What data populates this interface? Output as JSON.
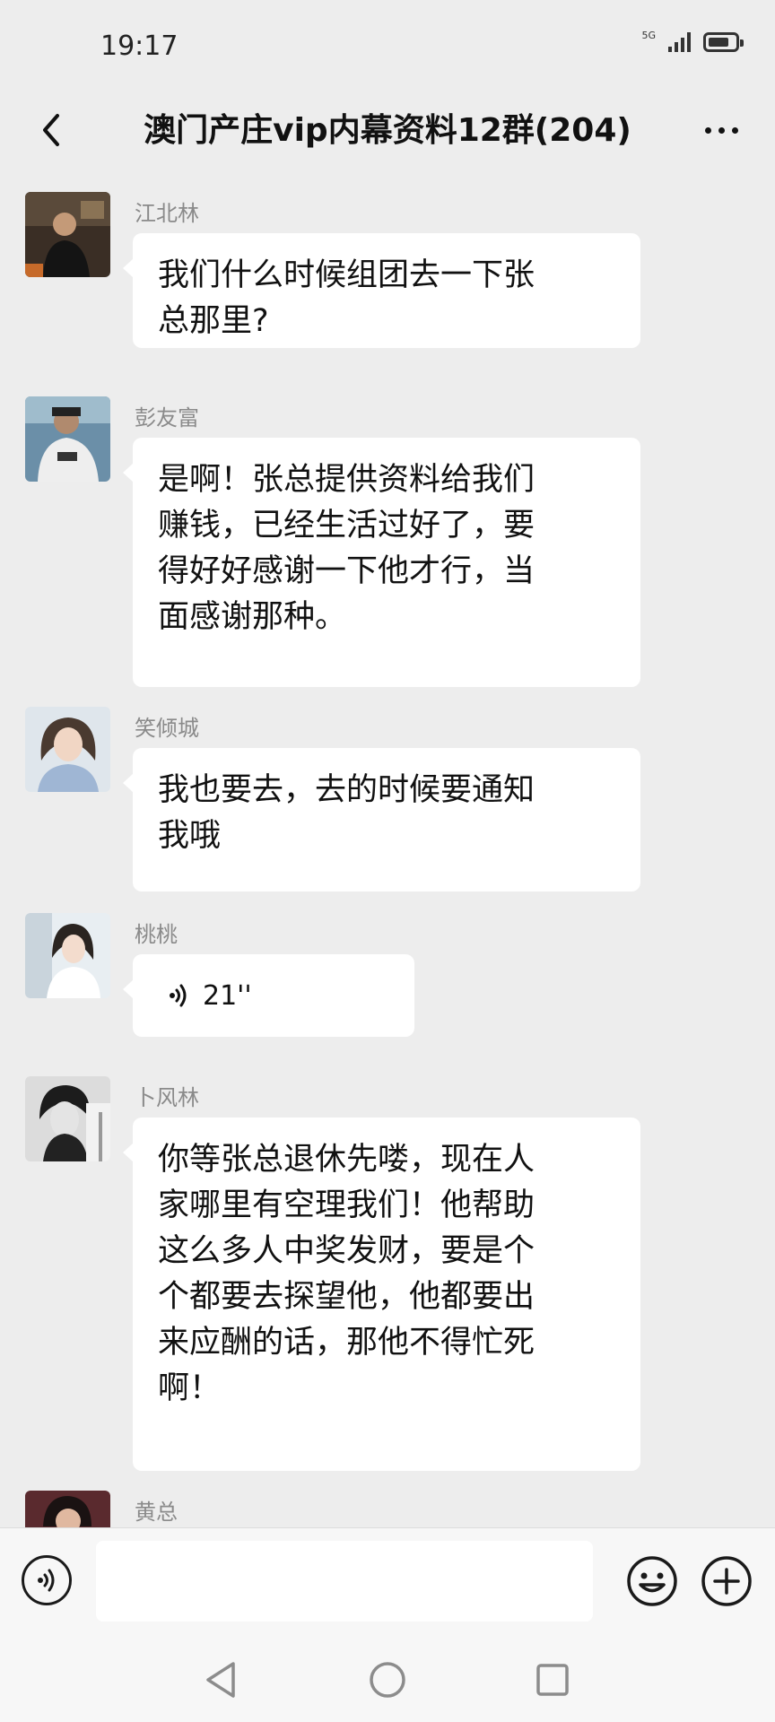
{
  "status_bar": {
    "time": "19:17",
    "network": "5G"
  },
  "header": {
    "title": "澳门产庄vip内幕资料12群(204)",
    "back_icon": "chevron-left-icon",
    "more_icon": "more-dots-icon"
  },
  "messages": [
    {
      "sender": "江北林",
      "lines": [
        "我们什么时候组团去一下张",
        "总那里?"
      ]
    },
    {
      "sender": "彭友富",
      "lines": [
        "是啊！张总提供资料给我们",
        "赚钱，已经生活过好了，要",
        "得好好感谢一下他才行，当",
        "面感谢那种。"
      ]
    },
    {
      "sender": "笑倾城",
      "lines": [
        "我也要去，去的时候要通知",
        "我哦"
      ]
    },
    {
      "sender": "桃桃",
      "voice_duration": "21''",
      "voice_icon": "voice-wave-icon"
    },
    {
      "sender": "卜风林",
      "lines": [
        "你等张总退休先喽，现在人",
        "家哪里有空理我们！他帮助",
        "这么多人中奖发财，要是个",
        "个都要去探望他，他都要出",
        "来应酬的话，那他不得忙死",
        "啊！"
      ]
    },
    {
      "sender": "黄总"
    }
  ],
  "input_bar": {
    "placeholder": "",
    "voice_icon": "voice-input-icon",
    "emoji_icon": "emoji-icon",
    "plus_icon": "plus-circle-icon"
  },
  "colors": {
    "background": "#ededed",
    "bubble": "#ffffff",
    "sender_name": "#8a8a8a",
    "bars": "#f7f7f7"
  }
}
